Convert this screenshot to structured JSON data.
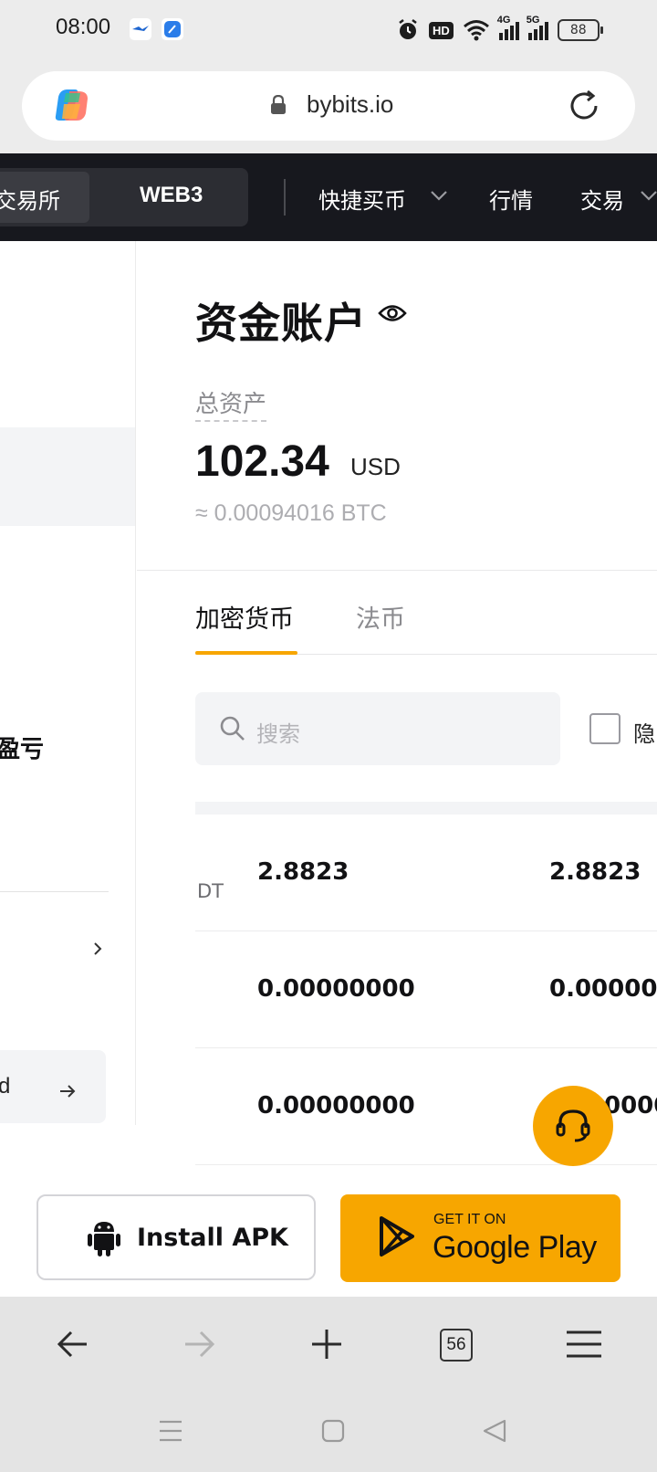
{
  "status_bar": {
    "time": "08:00",
    "network_1": "4G",
    "network_2": "5G",
    "hd_label": "HD",
    "battery": "88"
  },
  "browser": {
    "url": "bybits.io",
    "tab_count": "56"
  },
  "site_nav": {
    "segment_exchange": "交易所",
    "segment_web3": "WEB3",
    "quick_buy": "快捷买币",
    "markets": "行情",
    "trade": "交易"
  },
  "left_panel": {
    "item_pnl": "盈亏",
    "link_tail": "d"
  },
  "account": {
    "title": "资金账户",
    "total_label": "总资产",
    "balance": "102.34",
    "balance_unit": "USD",
    "balance_btc": "≈ 0.00094016 BTC"
  },
  "tabs": [
    {
      "label": "加密货币",
      "active": true
    },
    {
      "label": "法币",
      "active": false
    }
  ],
  "search": {
    "placeholder": "搜索"
  },
  "hide_small_label": "隐",
  "table": {
    "rows": [
      {
        "coin": "DT",
        "col1": "2.8823",
        "col2": "2.8823"
      },
      {
        "coin": "",
        "col1": "0.00000000",
        "col2": "0.000000"
      },
      {
        "coin": "",
        "col1": "0.00000000",
        "col2": "0000"
      }
    ]
  },
  "install": {
    "apk_label": "Install APK",
    "gp_small": "GET IT ON",
    "gp_big": "Google Play"
  },
  "colors": {
    "accent": "#f7a600",
    "nav_bg": "#17181e",
    "muted": "#adadb1"
  }
}
